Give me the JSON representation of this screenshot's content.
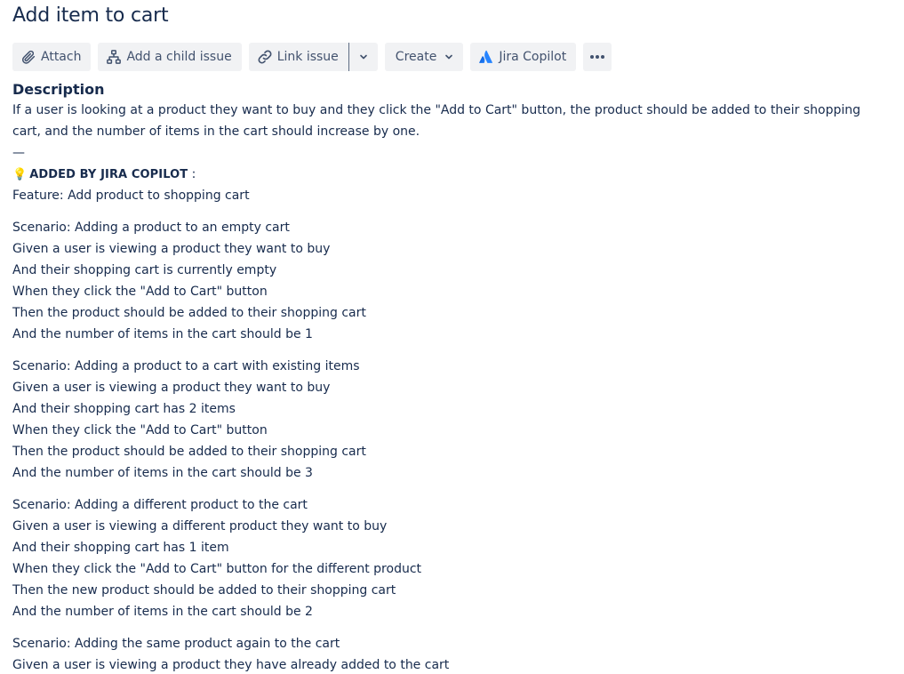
{
  "issue": {
    "title": "Add item to cart"
  },
  "toolbar": {
    "attach_label": "Attach",
    "child_issue_label": "Add a child issue",
    "link_issue_label": "Link issue",
    "create_label": "Create",
    "copilot_label": "Jira Copilot",
    "icons": {
      "attach": "paperclip-icon",
      "child_issue": "hierarchy-icon",
      "link_issue": "link-icon",
      "dropdown": "chevron-down-icon",
      "copilot": "atlassian-logo-icon",
      "more": "more-horizontal-icon"
    },
    "accent_color": "#0052cc",
    "button_bg": "#f1f2f4"
  },
  "description": {
    "heading": "Description",
    "intro": "If a user is looking at a product they want to buy and they click the \"Add to Cart\" button, the product should be added to their shopping cart, and the number of items in the cart should increase by one.",
    "separator": "—",
    "copilot_emoji": "💡",
    "copilot_tag": "ADDED BY JIRA COPILOT",
    "copilot_suffix": " :",
    "feature": "Feature: Add product to shopping cart",
    "scenarios": [
      {
        "lines": [
          "Scenario: Adding a product to an empty cart",
          "Given a user is viewing a product they want to buy",
          "And their shopping cart is currently empty",
          "When they click the \"Add to Cart\" button",
          "Then the product should be added to their shopping cart",
          "And the number of items in the cart should be 1"
        ]
      },
      {
        "lines": [
          "Scenario: Adding a product to a cart with existing items",
          "Given a user is viewing a product they want to buy",
          "And their shopping cart has 2 items",
          "When they click the \"Add to Cart\" button",
          "Then the product should be added to their shopping cart",
          "And the number of items in the cart should be 3"
        ]
      },
      {
        "lines": [
          "Scenario: Adding a different product to the cart",
          "Given a user is viewing a different product they want to buy",
          "And their shopping cart has 1 item",
          "When they click the \"Add to Cart\" button for the different product",
          "Then the new product should be added to their shopping cart",
          "And the number of items in the cart should be 2"
        ]
      },
      {
        "lines": [
          "Scenario: Adding the same product again to the cart",
          "Given a user is viewing a product they have already added to the cart"
        ]
      }
    ]
  }
}
